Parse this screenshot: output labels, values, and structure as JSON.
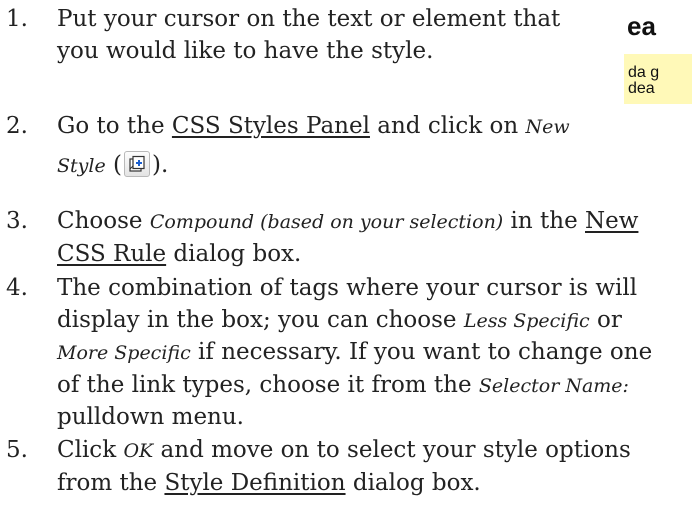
{
  "steps": [
    {
      "number": "1.",
      "line1": "Put your cursor on the text or element that",
      "line2": "you would like to have the style."
    },
    {
      "number": "2.",
      "part1": "Go to the ",
      "panel_link": "CSS Styles Panel",
      "part2": " and click on ",
      "new_italic": "New",
      "style_italic": "Style",
      "paren_open": " (",
      "paren_close": ").",
      "icon": "new-css-rule-icon"
    },
    {
      "number": "3.",
      "part1": "Choose ",
      "compound_italic": "Compound (based on your selection)",
      "part2": " in the ",
      "new_link": "New",
      "css_rule_link": "CSS Rule",
      "part3": " dialog box."
    },
    {
      "number": "4.",
      "line1": "The combination of tags where your cursor is will",
      "line2_part1": "display in the box; you can choose ",
      "less_specific": "Less Specific",
      "line2_part2": " or",
      "more_specific": "More Specific",
      "line3_part1": " if necessary. If you want to change one",
      "line4_part1": "of the link types, choose it from the ",
      "selector_name": "Selector Name:",
      "line5": "pulldown menu."
    },
    {
      "number": "5.",
      "part1": "Click ",
      "ok_italic": "OK",
      "part2": " and move on to select your style options",
      "line2_part1": "from the ",
      "style_def_link": "Style Definition",
      "line2_part2": " dialog box."
    }
  ],
  "snippet": {
    "heading_fragment": "ea",
    "line1": "da g",
    "line2": "dea",
    "highlight_color": "#fff9b8"
  }
}
